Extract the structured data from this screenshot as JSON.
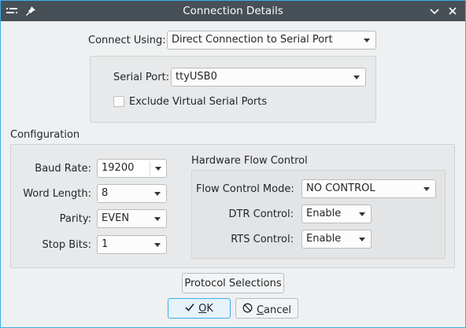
{
  "window": {
    "title": "Connection Details"
  },
  "connection": {
    "connect_using_label": "Connect Using:",
    "connect_using_value": "Direct Connection to Serial Port",
    "serial_port_label": "Serial Port:",
    "serial_port_value": "ttyUSB0",
    "exclude_virtual_label": "Exclude Virtual Serial Ports",
    "exclude_virtual_checked": false
  },
  "configuration": {
    "heading": "Configuration",
    "baud_rate_label": "Baud Rate:",
    "baud_rate_value": "19200",
    "word_length_label": "Word Length:",
    "word_length_value": "8",
    "parity_label": "Parity:",
    "parity_value": "EVEN",
    "stop_bits_label": "Stop Bits:",
    "stop_bits_value": "1"
  },
  "flow_control": {
    "heading": "Hardware Flow Control",
    "mode_label": "Flow Control Mode:",
    "mode_value": "NO CONTROL",
    "dtr_label": "DTR Control:",
    "dtr_value": "Enable",
    "rts_label": "RTS Control:",
    "rts_value": "Enable"
  },
  "buttons": {
    "protocol_selections": "Protocol Selections",
    "ok_first": "O",
    "ok_rest": "K",
    "cancel_first": "C",
    "cancel_rest": "ancel"
  },
  "icons": {
    "window_menu": "window-menu-icon",
    "pin": "pin-icon",
    "minimize": "chevron-down-icon",
    "close": "close-icon",
    "ok": "check-icon",
    "cancel": "cancel-icon"
  },
  "colors": {
    "titlebar": "#475057",
    "accent": "#3daee9",
    "window_bg": "#eff0f1"
  }
}
